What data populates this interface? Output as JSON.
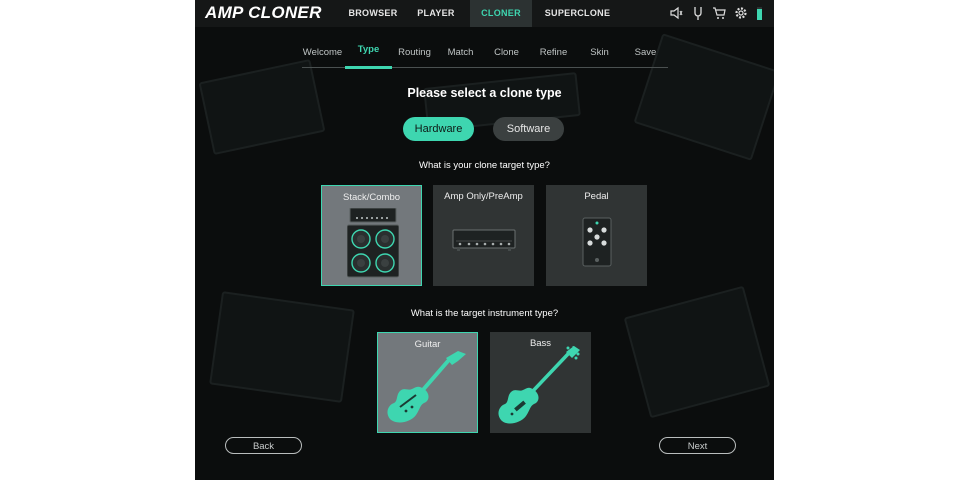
{
  "app": {
    "logo": "AMP CLONER"
  },
  "topnav": {
    "items": [
      {
        "label": "BROWSER",
        "active": false
      },
      {
        "label": "PLAYER",
        "active": false
      },
      {
        "label": "CLONER",
        "active": true
      },
      {
        "label": "SUPERCLONE",
        "active": false
      }
    ],
    "icons": [
      "speaker-icon",
      "tuning-fork-icon",
      "cart-icon",
      "gear-icon",
      "level-meter-icon"
    ]
  },
  "steps": {
    "items": [
      "Welcome",
      "Type",
      "Routing",
      "Match",
      "Clone",
      "Refine",
      "Skin",
      "Save"
    ],
    "active_index": 1
  },
  "clone_type": {
    "title": "Please select a clone type",
    "options": [
      {
        "label": "Hardware",
        "selected": true
      },
      {
        "label": "Software",
        "selected": false
      }
    ]
  },
  "target_type": {
    "question": "What is your clone target type?",
    "options": [
      {
        "label": "Stack/Combo",
        "selected": true
      },
      {
        "label": "Amp Only/PreAmp",
        "selected": false
      },
      {
        "label": "Pedal",
        "selected": false
      }
    ]
  },
  "instrument": {
    "question": "What is the target instrument type?",
    "options": [
      {
        "label": "Guitar",
        "selected": true
      },
      {
        "label": "Bass",
        "selected": false
      }
    ]
  },
  "footer": {
    "back_label": "Back",
    "next_label": "Next"
  },
  "colors": {
    "accent": "#3ed6b0",
    "background": "#0b0d0d",
    "card": "#303434",
    "card_selected": "#73787c"
  }
}
